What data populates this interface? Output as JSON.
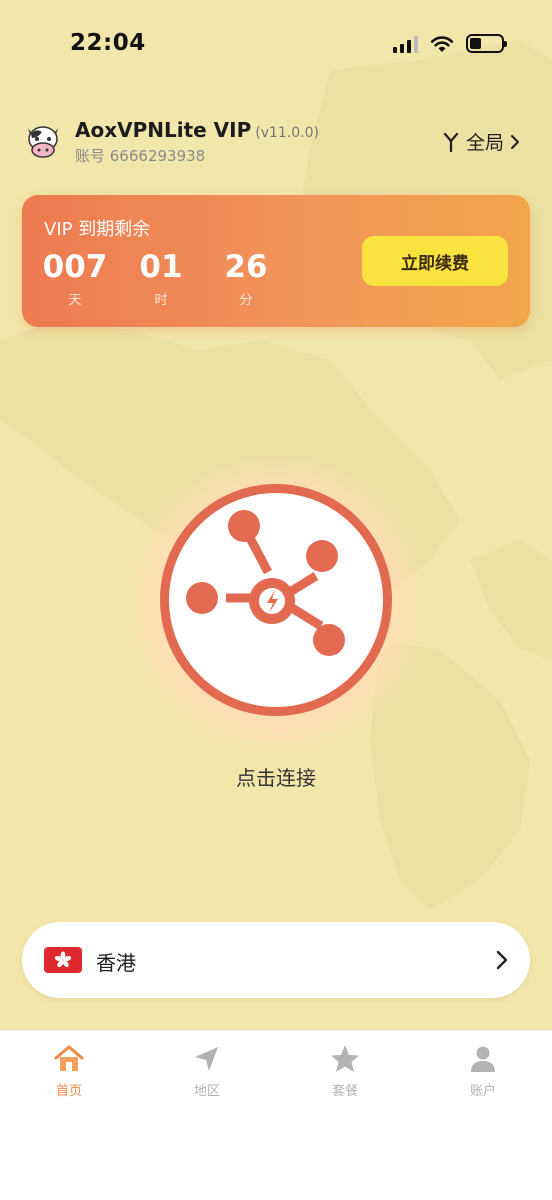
{
  "status_bar": {
    "time": "22:04",
    "battery_level": 0.35
  },
  "header": {
    "app_name": "AoxVPNLite VIP",
    "version": "(v11.0.0)",
    "account": "账号 6666293938",
    "mode_label": "全局"
  },
  "vip": {
    "title": "VIP 到期剩余",
    "countdown": [
      {
        "value": "007",
        "unit": "天"
      },
      {
        "value": "01",
        "unit": "时"
      },
      {
        "value": "26",
        "unit": "分"
      }
    ],
    "renew_label": "立即续费"
  },
  "connect": {
    "label": "点击连接"
  },
  "region": {
    "name": "香港"
  },
  "tabs": [
    {
      "label": "首页",
      "icon": "home-icon",
      "active": true
    },
    {
      "label": "地区",
      "icon": "location-arrow-icon",
      "active": false
    },
    {
      "label": "套餐",
      "icon": "star-icon",
      "active": false
    },
    {
      "label": "账户",
      "icon": "person-icon",
      "active": false
    }
  ],
  "colors": {
    "background": "#f3e6ab",
    "accent": "#e26a50",
    "renew_button": "#f9e33f",
    "tab_active": "#ef8a45",
    "tab_inactive": "#b3b3b3"
  }
}
